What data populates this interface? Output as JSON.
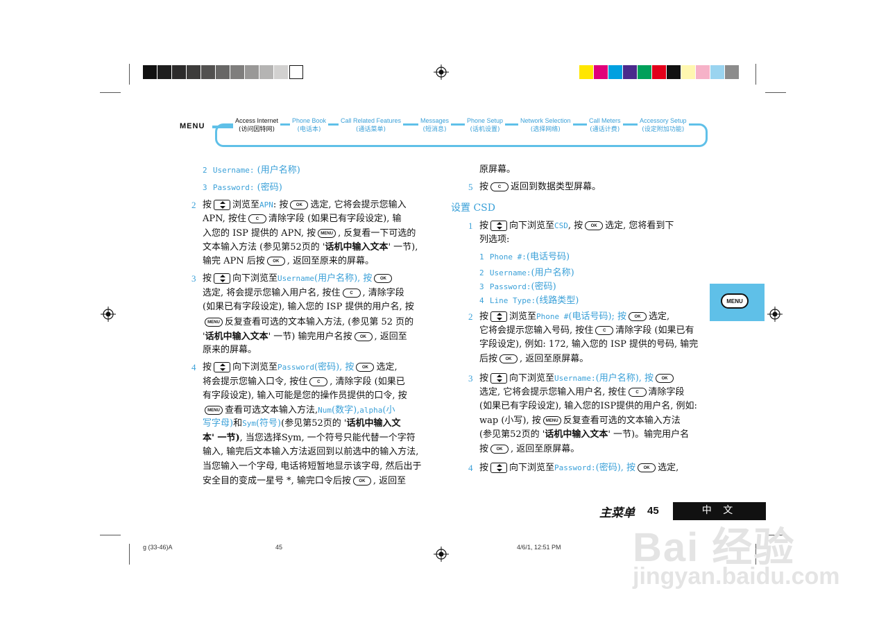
{
  "colors": {
    "accent": "#3aa0d8",
    "frame": "#5fc0e8",
    "gray_swatches": [
      "#111111",
      "#1e1e1e",
      "#2c2b2b",
      "#3d3c3b",
      "#525150",
      "#686766",
      "#7f7e7d",
      "#999897",
      "#b5b4b3",
      "#d2d1d0",
      "#ffffff"
    ],
    "color_swatches": [
      "#ffe600",
      "#e0007a",
      "#00a0e0",
      "#4a2a8c",
      "#00a05a",
      "#e2001a",
      "#111111",
      "#fff7b0",
      "#f6b2c8",
      "#9ad4f0",
      "#8c8c8c"
    ]
  },
  "header": {
    "menu_label": "MENU",
    "nav": [
      {
        "en": "Access Internet",
        "cn": "(访问因特网)"
      },
      {
        "en": "Phone Book",
        "cn": "(电话本)"
      },
      {
        "en": "Call Related Features",
        "cn": "(通话菜单)"
      },
      {
        "en": "Messages",
        "cn": "(短消息)"
      },
      {
        "en": "Phone Setup",
        "cn": "(话机设置)"
      },
      {
        "en": "Network Selection",
        "cn": "(选择网络)"
      },
      {
        "en": "Call Meters",
        "cn": "(通话计费)"
      },
      {
        "en": "Accessory Setup",
        "cn": "(设定附加功能)"
      }
    ]
  },
  "keys": {
    "ok": "OK",
    "c": "C",
    "menu": "MENU"
  },
  "left": {
    "sub2_num": "2",
    "sub2_code": "Username:",
    "sub2_cn": "(用户名称)",
    "sub3_num": "3",
    "sub3_code": "Password:",
    "sub3_cn": "(密码)",
    "s2_num": "2",
    "s2": [
      "按",
      "浏览至",
      "APN",
      ": 按",
      "选定, 它将会提示您输入",
      "APN, 按住",
      "清除字段 (如果已有字段设定), 输",
      "入您的 ISP 提供的 APN, 按",
      ", 反复看一下可选的",
      "文本输入方法 (参见第52页的 '",
      "话机中输入文本",
      "' 一节),",
      "输完 APN 后按",
      ", 返回至原来的屏幕。"
    ],
    "s3_num": "3",
    "s3": [
      "按",
      "向下浏览至",
      "Username",
      "(用户名称), 按",
      "选定, 将会提示您输入用户名, 按住",
      ", 清除字段",
      "(如果已有字段设定), 输入您的 ISP 提供的用户名, 按",
      "反复查看可选的文本输入方法, (参见第 52 页的",
      "'",
      "话机中输入文本",
      "' 一节) 输完用户名按",
      ", 返回至",
      "原来的屏幕。"
    ],
    "s4_num": "4",
    "s4": [
      "按",
      "向下浏览至",
      "Password",
      "(密码), 按",
      "选定,",
      "将会提示您输入口令, 按住",
      ", 清除字段 (如果已",
      "有字段设定), 输入可能是您的操作员提供的口令, 按",
      "查看可选文本输入方法,",
      "Num",
      "(数字),",
      "alpha",
      "(小",
      "写字母)",
      "和",
      "Sym",
      "(符号)",
      "(参见第52页的 '",
      "话机中输入文",
      "本' 一节)",
      ", 当您选择Sym, 一个符号只能代替一个字符",
      "输入, 输完后文本输入方法返回到以前选中的输入方法,",
      "当您输入一个字母, 电话将短暂地显示该字母, 然后出于",
      "安全目的变成一星号 *, 输完口令后按",
      ", 返回至"
    ]
  },
  "right": {
    "top_line": "原屏幕。",
    "s5_num": "5",
    "s5_a": "按",
    "s5_b": "返回到数据类型屏幕。",
    "section_title": "设置 CSD",
    "c1_num": "1",
    "c1": [
      "按",
      "向下浏览至",
      "CSD",
      ", 按",
      "选定, 您将看到下",
      "列选项:"
    ],
    "opts": [
      {
        "num": "1",
        "code": "Phone #:",
        "cn": "(电话号码)"
      },
      {
        "num": "2",
        "code": "Username:",
        "cn": "(用户名称)"
      },
      {
        "num": "3",
        "code": "Password:",
        "cn": "(密码)"
      },
      {
        "num": "4",
        "code": "Line Type:",
        "cn": "(线路类型)"
      }
    ],
    "c2_num": "2",
    "c2": [
      "按",
      "浏览至",
      "Phone #",
      "(电话号码); 按",
      "选定,",
      "它将会提示您输入号码, 按住",
      "清除字段 (如果已有",
      "字段设定), 例如: 172, 输入您的 ISP 提供的号码, 输完",
      "后按",
      ", 返回至原屏幕。"
    ],
    "c3_num": "3",
    "c3": [
      "按",
      "向下浏览至",
      "Username:",
      "(用户名称), 按",
      "选定, 它将会提示您输入用户名, 按住",
      "清除字段",
      "(如果已有字段设定), 输入您的ISP提供的用户名, 例如:",
      "wap (小写), 按",
      "反复查看可选的文本输入方法",
      "(参见第52页的 '",
      "话机中输入文本",
      "' 一节)。输完用户名",
      "按",
      ", 返回至原屏幕。"
    ],
    "c4_num": "4",
    "c4": [
      "按",
      "向下浏览至",
      "Password:",
      "(密码), 按",
      "选定,"
    ]
  },
  "side_tab": {
    "label": "MENU"
  },
  "footer": {
    "title": "主菜单",
    "page": "45",
    "lang": "中 文"
  },
  "slug": {
    "left": "g  (33-46)A",
    "mid": "45",
    "right": "4/6/1, 12:51 PM"
  },
  "watermark": {
    "line1": "Bai 经验",
    "line2": "jingyan.baidu.com"
  }
}
